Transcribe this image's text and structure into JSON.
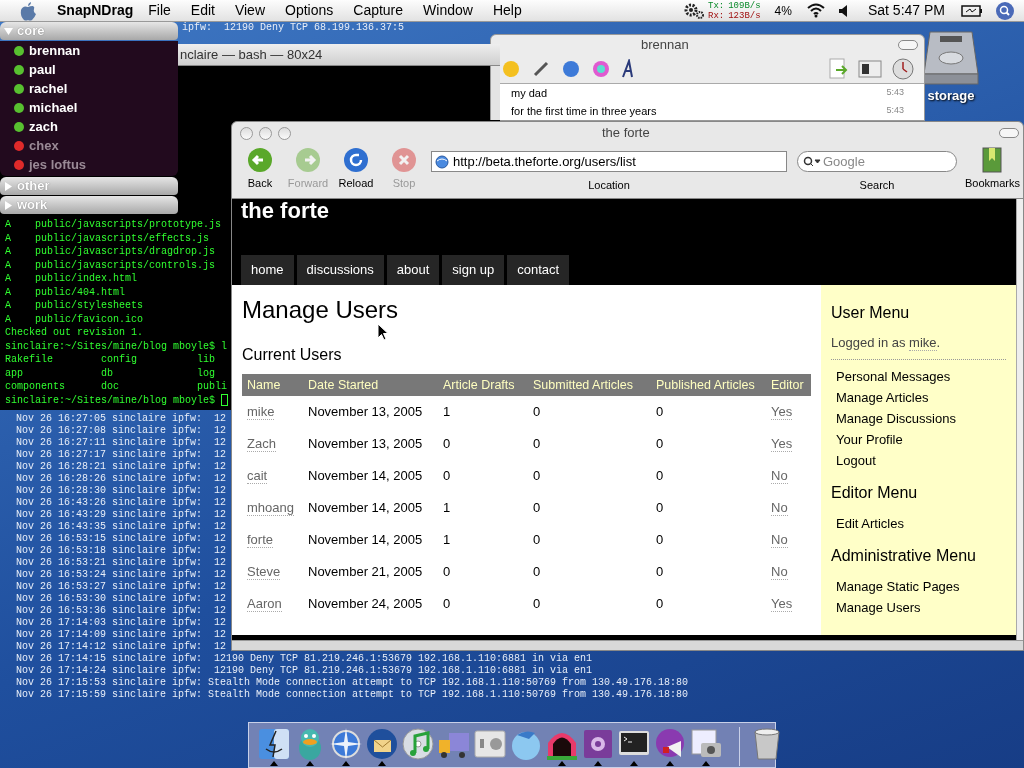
{
  "menu_bar": {
    "app_name": "SnapNDrag",
    "menus": [
      "File",
      "Edit",
      "View",
      "Options",
      "Capture",
      "Window",
      "Help"
    ],
    "tx_label": "Tx:",
    "tx_value": "109B/s",
    "rx_label": "Rx:",
    "rx_value": "123B/s",
    "cpu": "4%",
    "clock": "Sat 5:47 PM"
  },
  "console_log": {
    "top_fragment": "ipfw:  12190 Deny TCP 68.199.136.37:5",
    "lines": [
      "Nov 26 16:27:05 sinclaire ipfw:  12",
      "Nov 26 16:27:08 sinclaire ipfw:  12",
      "Nov 26 16:27:11 sinclaire ipfw:  12",
      "Nov 26 16:27:17 sinclaire ipfw:  12",
      "Nov 26 16:28:21 sinclaire ipfw:  12",
      "Nov 26 16:28:26 sinclaire ipfw:  12",
      "Nov 26 16:28:30 sinclaire ipfw:  12",
      "Nov 26 16:43:26 sinclaire ipfw:  12",
      "Nov 26 16:43:29 sinclaire ipfw:  12",
      "Nov 26 16:43:35 sinclaire ipfw:  12",
      "Nov 26 16:53:15 sinclaire ipfw:  12",
      "Nov 26 16:53:18 sinclaire ipfw:  12",
      "Nov 26 16:53:21 sinclaire ipfw:  12",
      "Nov 26 16:53:24 sinclaire ipfw:  12",
      "Nov 26 16:53:27 sinclaire ipfw:  12",
      "Nov 26 16:53:30 sinclaire ipfw:  12",
      "Nov 26 16:53:36 sinclaire ipfw:  12",
      "Nov 26 17:14:03 sinclaire ipfw:  12",
      "Nov 26 17:14:09 sinclaire ipfw:  12",
      "Nov 26 17:14:12 sinclaire ipfw:  12",
      "Nov 26 17:14:15 sinclaire ipfw:  12190 Deny TCP 81.219.246.1:53679 192.168.1.110:6881 in via en1",
      "Nov 26 17:14:24 sinclaire ipfw:  12190 Deny TCP 81.219.246.1:53679 192.168.1.110:6881 in via en1",
      "Nov 26 17:15:53 sinclaire ipfw: Stealth Mode connection attempt to TCP 192.168.1.110:50769 from 130.49.176.18:80",
      "Nov 26 17:15:59 sinclaire ipfw: Stealth Mode connection attempt to TCP 192.168.1.110:50769 from 130.49.176.18:80"
    ]
  },
  "terminal": {
    "title": "nclaire — bash — 80x24",
    "lines": [
      "A    public/javascripts/prototype.js",
      "A    public/javascripts/effects.js",
      "A    public/javascripts/dragdrop.js",
      "A    public/javascripts/controls.js",
      "A    public/index.html",
      "A    public/404.html",
      "A    public/stylesheets",
      "A    public/favicon.ico",
      "Checked out revision 1.",
      "sinclaire:~/Sites/mine/blog mboyle$ l",
      "Rakefile        config          lib",
      "app             db              log",
      "components      doc             publi"
    ],
    "prompt": "sinclaire:~/Sites/mine/blog mboyle$"
  },
  "buddy_list": {
    "groups": [
      {
        "name": "core",
        "expanded": true,
        "buddies": [
          {
            "name": "brennan",
            "online": true
          },
          {
            "name": "paul",
            "online": true
          },
          {
            "name": "rachel",
            "online": true
          },
          {
            "name": "michael",
            "online": true
          },
          {
            "name": "zach",
            "online": true
          },
          {
            "name": "chex",
            "online": false
          },
          {
            "name": "jes loftus",
            "online": false
          }
        ]
      },
      {
        "name": "other",
        "expanded": false
      },
      {
        "name": "work",
        "expanded": false
      }
    ]
  },
  "chat_window": {
    "title": "brennan",
    "messages": [
      {
        "text": "my dad",
        "time": "5:43"
      },
      {
        "text": "for the first time in three years",
        "time": "5:43"
      }
    ]
  },
  "desktop_icons": [
    {
      "label": "storage"
    }
  ],
  "browser": {
    "title": "the forte",
    "buttons": [
      {
        "kind": "back",
        "label": "Back",
        "disabled": false
      },
      {
        "kind": "forward",
        "label": "Forward",
        "disabled": true
      },
      {
        "kind": "reload",
        "label": "Reload",
        "disabled": false
      },
      {
        "kind": "stop",
        "label": "Stop",
        "disabled": true
      }
    ],
    "url": "http://beta.theforte.org/users/list",
    "location_label": "Location",
    "search_placeholder": "Google",
    "search_label": "Search",
    "bookmarks_label": "Bookmarks",
    "page": {
      "site_title": "the forte",
      "nav": [
        "home",
        "discussions",
        "about",
        "sign up",
        "contact"
      ],
      "heading": "Manage Users",
      "subheading": "Current Users",
      "table": {
        "columns": [
          "Name",
          "Date Started",
          "Article Drafts",
          "Submitted Articles",
          "Published Articles",
          "Editor"
        ],
        "rows": [
          [
            "mike",
            "November 13, 2005",
            "1",
            "0",
            "0",
            "Yes"
          ],
          [
            "Zach",
            "November 13, 2005",
            "0",
            "0",
            "0",
            "Yes"
          ],
          [
            "cait",
            "November 14, 2005",
            "0",
            "0",
            "0",
            "No"
          ],
          [
            "mhoang",
            "November 14, 2005",
            "1",
            "0",
            "0",
            "No"
          ],
          [
            "forte",
            "November 14, 2005",
            "1",
            "0",
            "0",
            "No"
          ],
          [
            "Steve",
            "November 21, 2005",
            "0",
            "0",
            "0",
            "No"
          ],
          [
            "Aaron",
            "November 24, 2005",
            "0",
            "0",
            "0",
            "Yes"
          ]
        ]
      },
      "sidebar": [
        {
          "title": "User Menu",
          "login": {
            "before": "Logged in as ",
            "user": "mike",
            "after": "."
          },
          "links": [
            "Personal Messages",
            "Manage Articles",
            "Manage Discussions",
            "Your Profile",
            "Logout"
          ]
        },
        {
          "title": "Editor Menu",
          "links": [
            "Edit Articles"
          ]
        },
        {
          "title": "Administrative Menu",
          "links": [
            "Manage Static Pages",
            "Manage Users"
          ]
        }
      ]
    }
  },
  "dock": {
    "items": [
      {
        "kind": "finder",
        "running": true
      },
      {
        "kind": "duck",
        "running": true
      },
      {
        "kind": "compass",
        "running": true
      },
      {
        "kind": "mailbird",
        "running": true
      },
      {
        "kind": "music",
        "running": false
      },
      {
        "kind": "truck",
        "running": false
      },
      {
        "kind": "prefs",
        "running": false
      },
      {
        "kind": "fishbowl",
        "running": false
      },
      {
        "kind": "tunnel",
        "running": true
      },
      {
        "kind": "editor",
        "running": true
      },
      {
        "kind": "terminal",
        "running": true
      },
      {
        "kind": "globe",
        "running": true
      },
      {
        "kind": "photo",
        "running": true
      },
      {
        "kind": "trash",
        "running": false
      }
    ]
  }
}
